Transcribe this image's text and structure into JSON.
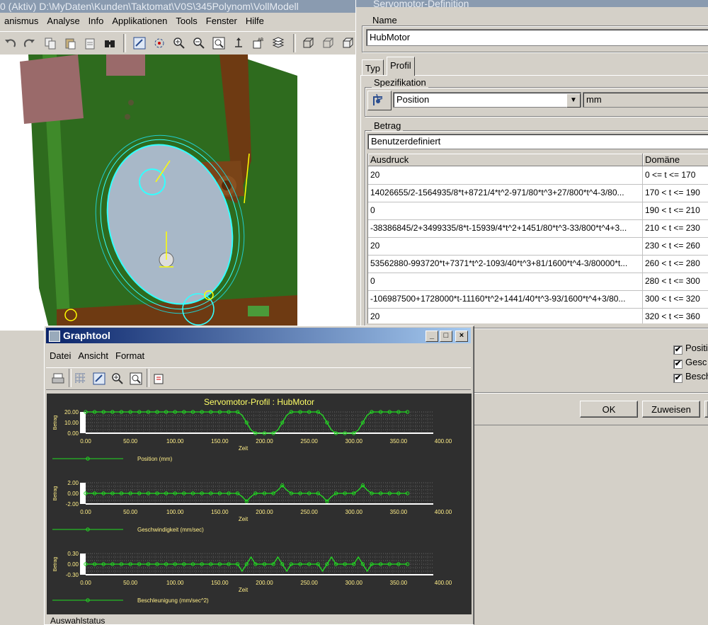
{
  "main_window": {
    "title": "0 (Aktiv) D:\\MyDaten\\Kunden\\Taktomat\\V0S\\345Polynom\\VollModell",
    "menu": [
      "anismus",
      "Analyse",
      "Info",
      "Applikationen",
      "Tools",
      "Fenster",
      "Hilfe"
    ],
    "toolbar_icons": [
      "undo-icon",
      "redo-icon",
      "copy-icon",
      "paste-icon",
      "clipboard-icon",
      "binoculars-icon",
      "repaint-icon",
      "spin-center-icon",
      "zoom-in-icon",
      "zoom-out-icon",
      "refit-icon",
      "orient-icon",
      "saved-views-icon",
      "layers-icon",
      "wireframe-icon",
      "hidden-line-icon",
      "no-hidden-icon"
    ]
  },
  "dialog": {
    "title": "Servomotor-Definition",
    "name_label": "Name",
    "name_value": "HubMotor",
    "tabs": [
      "Typ",
      "Profil"
    ],
    "active_tab": "Profil",
    "spec_label": "Spezifikation",
    "spec_value": "Position",
    "spec_unit": "mm",
    "betrag_label": "Betrag",
    "betrag_value": "Benutzerdefiniert",
    "table": {
      "headers": [
        "Ausdruck",
        "Domäne"
      ],
      "rows": [
        {
          "expr": "20",
          "domain": "0 <= t <= 170"
        },
        {
          "expr": "14026655/2-1564935/8*t+8721/4*t^2-971/80*t^3+27/800*t^4-3/80...",
          "domain": "170 < t <= 190"
        },
        {
          "expr": "0",
          "domain": "190 < t <= 210"
        },
        {
          "expr": "-38386845/2+3499335/8*t-15939/4*t^2+1451/80*t^3-33/800*t^4+3...",
          "domain": "210 < t <= 230"
        },
        {
          "expr": "20",
          "domain": "230 < t <= 260"
        },
        {
          "expr": "53562880-993720*t+7371*t^2-1093/40*t^3+81/1600*t^4-3/80000*t...",
          "domain": "260 < t <= 280"
        },
        {
          "expr": "0",
          "domain": "280 < t <= 300"
        },
        {
          "expr": "-106987500+1728000*t-11160*t^2+1441/40*t^3-93/1600*t^4+3/80...",
          "domain": "300 < t <= 320"
        },
        {
          "expr": "20",
          "domain": "320 < t <= 360"
        }
      ]
    },
    "checkboxes": [
      {
        "label": "Positi",
        "checked": true,
        "mark": "✔"
      },
      {
        "label": "Gesc",
        "checked": true,
        "mark": "✔"
      },
      {
        "label": "Besch",
        "checked": true,
        "mark": "✔"
      }
    ],
    "buttons": {
      "ok": "OK",
      "apply": "Zuweisen"
    }
  },
  "graphtool": {
    "title": "Graphtool",
    "menu": [
      "Datei",
      "Ansicht",
      "Format"
    ],
    "toolbar_icons": [
      "print-icon",
      "grid-toggle-icon",
      "repaint-icon",
      "zoom-in-icon",
      "refit-icon",
      "export-icon"
    ],
    "window_buttons": {
      "minimize": "_",
      "maximize": "□",
      "close": "×"
    },
    "status": "Auswahlstatus"
  },
  "colors": {
    "plot_bg": "#2f2f2f",
    "curve": "#22dd22",
    "title_text": "#ffff66",
    "label_text": "#ffee88"
  },
  "chart_data": [
    {
      "type": "line",
      "title": "Servomotor-Profil : HubMotor",
      "xlabel": "Zeit",
      "ylabel": "Betrag",
      "xlim": [
        0,
        400
      ],
      "ylim": [
        0,
        20
      ],
      "xticks": [
        "0.00",
        "50.00",
        "100.00",
        "150.00",
        "200.00",
        "250.00",
        "300.00",
        "350.00",
        "400.00"
      ],
      "yticks": [
        "20.00",
        "10.00",
        "0.00"
      ],
      "series": [
        {
          "name": "Position (mm)",
          "x": [
            0,
            170,
            175,
            180,
            185,
            190,
            210,
            215,
            220,
            225,
            230,
            260,
            265,
            270,
            275,
            280,
            300,
            305,
            310,
            315,
            320,
            360
          ],
          "y": [
            20,
            20,
            17,
            10,
            3,
            0,
            0,
            3,
            10,
            17,
            20,
            20,
            17,
            10,
            3,
            0,
            0,
            3,
            10,
            17,
            20,
            20
          ]
        }
      ]
    },
    {
      "type": "line",
      "title": "",
      "xlabel": "Zeit",
      "ylabel": "Betrag",
      "xlim": [
        0,
        400
      ],
      "ylim": [
        -2,
        2
      ],
      "xticks": [
        "0.00",
        "50.00",
        "100.00",
        "150.00",
        "200.00",
        "250.00",
        "300.00",
        "350.00",
        "400.00"
      ],
      "yticks": [
        "2.00",
        "0.00",
        "-2.00"
      ],
      "series": [
        {
          "name": "Geschwindigkeit (mm/sec)",
          "x": [
            0,
            170,
            175,
            180,
            185,
            190,
            210,
            215,
            220,
            225,
            230,
            260,
            265,
            270,
            275,
            280,
            300,
            305,
            310,
            315,
            320,
            360
          ],
          "y": [
            0,
            0,
            -0.6,
            -1.5,
            -0.6,
            0,
            0,
            0.6,
            1.5,
            0.6,
            0,
            0,
            -0.6,
            -1.5,
            -0.6,
            0,
            0,
            0.6,
            1.5,
            0.6,
            0,
            0
          ]
        }
      ]
    },
    {
      "type": "line",
      "title": "",
      "xlabel": "Zeit",
      "ylabel": "Betrag",
      "xlim": [
        0,
        400
      ],
      "ylim": [
        -0.3,
        0.3
      ],
      "xticks": [
        "0.00",
        "50.00",
        "100.00",
        "150.00",
        "200.00",
        "250.00",
        "300.00",
        "350.00",
        "400.00"
      ],
      "yticks": [
        "0.30",
        "0.00",
        "-0.30"
      ],
      "series": [
        {
          "name": "Beschleunigung (mm/sec^2)",
          "x": [
            0,
            170,
            175,
            180,
            185,
            190,
            195,
            200,
            205,
            210,
            215,
            220,
            225,
            230,
            260,
            265,
            270,
            275,
            280,
            285,
            290,
            295,
            300,
            305,
            310,
            315,
            320,
            360
          ],
          "y": [
            0,
            0,
            -0.2,
            0,
            0.2,
            0,
            0,
            0,
            0,
            0,
            0.2,
            0,
            -0.2,
            0,
            0,
            -0.2,
            0,
            0.2,
            0,
            0,
            0,
            0,
            0,
            0.2,
            0,
            -0.2,
            0,
            0
          ]
        }
      ]
    }
  ]
}
